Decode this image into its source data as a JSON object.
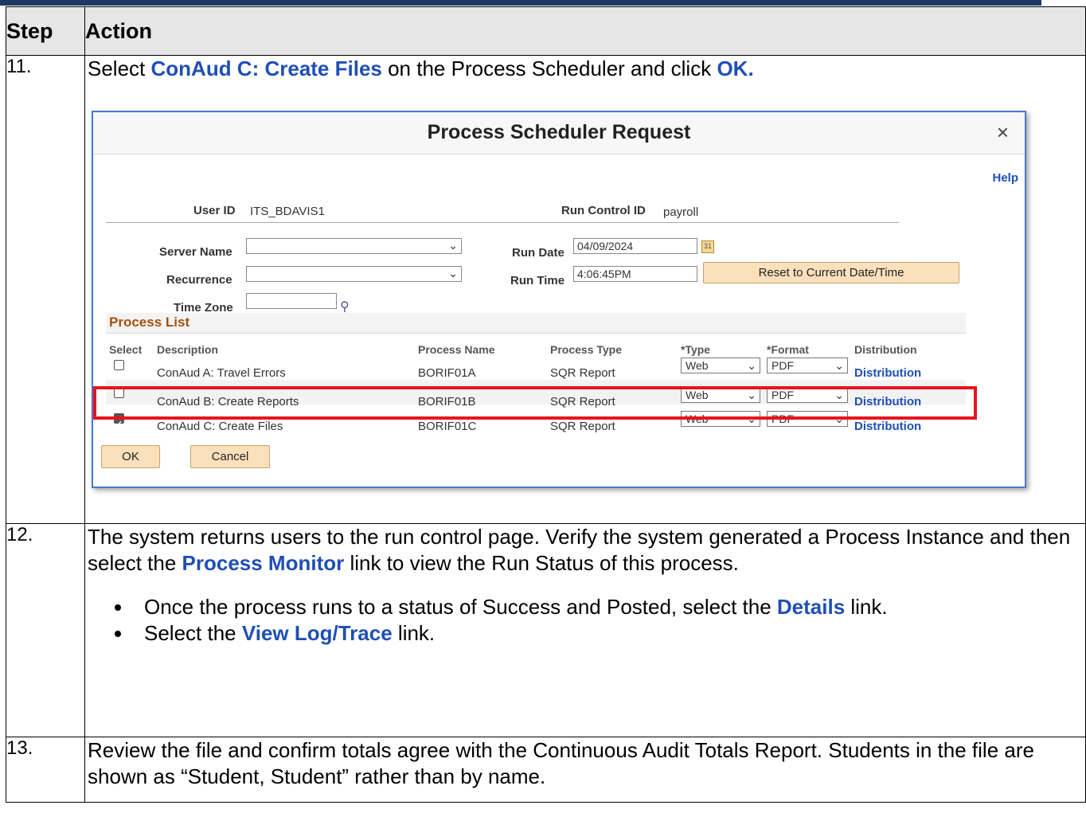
{
  "header": {
    "step": "Step",
    "action": "Action"
  },
  "step11": {
    "num": "11.",
    "pre": "Select ",
    "highlight": "ConAud C: Create Files",
    "mid": " on the Process Scheduler and click ",
    "ok": "OK.",
    "dialog": {
      "title": "Process Scheduler Request",
      "close": "×",
      "help": "Help",
      "user_id_label": "User ID",
      "user_id_value": "ITS_BDAVIS1",
      "run_control_label": "Run Control ID",
      "run_control_value": "payroll",
      "server_name_label": "Server Name",
      "recurrence_label": "Recurrence",
      "time_zone_label": "Time Zone",
      "run_date_label": "Run Date",
      "run_date_value": "04/09/2024",
      "run_time_label": "Run Time",
      "run_time_value": "4:06:45PM",
      "reset_button": "Reset to Current Date/Time",
      "process_list_title": "Process List",
      "columns": [
        "Select",
        "Description",
        "Process Name",
        "Process Type",
        "*Type",
        "*Format",
        "Distribution"
      ],
      "rows": [
        {
          "checked": false,
          "description": "ConAud A: Travel Errors",
          "process_name": "BORIF01A",
          "process_type": "SQR Report",
          "type": "Web",
          "format": "PDF",
          "distribution": "Distribution"
        },
        {
          "checked": false,
          "description": "ConAud B: Create Reports",
          "process_name": "BORIF01B",
          "process_type": "SQR Report",
          "type": "Web",
          "format": "PDF",
          "distribution": "Distribution"
        },
        {
          "checked": true,
          "description": "ConAud C: Create Files",
          "process_name": "BORIF01C",
          "process_type": "SQR Report",
          "type": "Web",
          "format": "PDF",
          "distribution": "Distribution"
        }
      ],
      "ok_button": "OK",
      "cancel_button": "Cancel",
      "highlight_color": "#e6141e"
    }
  },
  "step12": {
    "num": "12.",
    "p1": "The system returns users to the run control page. Verify the system generated a Process Instance and then select the ",
    "link1": "Process Monitor",
    "p2": " link to view the Run Status of this process.",
    "b1_pre": "Once the process runs to a status of Success and Posted, select the ",
    "b1_link": "Details",
    "b1_post": " link.",
    "b2_pre": "Select the ",
    "b2_link": "View Log/Trace",
    "b2_post": " link."
  },
  "step13": {
    "num": "13.",
    "text": "Review the file and confirm totals agree with the Continuous Audit Totals Report. Students in the file are shown as “Student, Student” rather than by name."
  },
  "colors": {
    "accent_blue": "#1f4fb5",
    "header_bg": "#e6e6e6",
    "top_bar": "#1f3864"
  }
}
